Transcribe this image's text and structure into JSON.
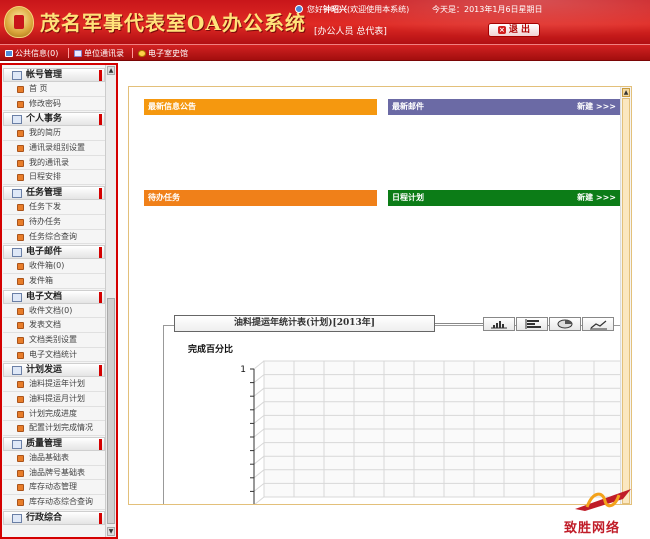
{
  "header": {
    "title": "茂名军事代表室OA办公系统",
    "welcome_prefix": "您好",
    "user_name": "钟昭兴",
    "welcome_suffix": "(欢迎使用本系统)",
    "date_text": "今天是：2013年1月6日星期日",
    "role_text": "[办公人员 总代表]",
    "logout_label": "退 出"
  },
  "toolbar": {
    "items": [
      {
        "label": "公共信息(0)"
      },
      {
        "label": "单位通讯录"
      },
      {
        "label": "电子室史馆"
      }
    ]
  },
  "sidebar": {
    "groups": [
      {
        "title": "帐号管理",
        "items": [
          "首 页",
          "修改密码"
        ]
      },
      {
        "title": "个人事务",
        "items": [
          "我的简历",
          "通讯录组别设置",
          "我的通讯录",
          "日程安排"
        ]
      },
      {
        "title": "任务管理",
        "items": [
          "任务下发",
          "待办任务",
          "任务综合查询"
        ]
      },
      {
        "title": "电子邮件",
        "items": [
          "收件箱(0)",
          "发件箱"
        ]
      },
      {
        "title": "电子文档",
        "items": [
          "收件文档(0)",
          "发表文档",
          "文档类别设置",
          "电子文档统计"
        ]
      },
      {
        "title": "计划发运",
        "items": [
          "油料提运年计划",
          "油料提运月计划",
          "计划完成进度",
          "配置计划完成情况"
        ]
      },
      {
        "title": "质量管理",
        "items": [
          "油品基础表",
          "油品牌号基础表",
          "库存动态管理",
          "库存动态综合查询"
        ]
      },
      {
        "title": "行政综合",
        "items": []
      }
    ]
  },
  "panels": [
    {
      "title": "最新信息公告",
      "more": "",
      "color": "#f5980f"
    },
    {
      "title": "最新邮件",
      "more": "新建 >>>",
      "color": "#6b6aa5"
    },
    {
      "title": "待办任务",
      "more": "",
      "color": "#f08019"
    },
    {
      "title": "日程计划",
      "more": "新建 >>>",
      "color": "#0c7c17"
    }
  ],
  "chart": {
    "title": "油料提运年统计表(计划)[2013年]",
    "ylabel": "完成百分比",
    "toolbar": [
      "bar-chart-icon",
      "horizontal-bar-icon",
      "pie-chart-icon",
      "line-chart-icon"
    ]
  },
  "chart_data": {
    "type": "bar",
    "title": "油料提运年统计表(计划)[2013年]",
    "ylabel": "完成百分比",
    "yticks": [
      "1"
    ],
    "categories": [],
    "values": [],
    "grid": true
  },
  "watermark": {
    "text": "致胜网络"
  }
}
